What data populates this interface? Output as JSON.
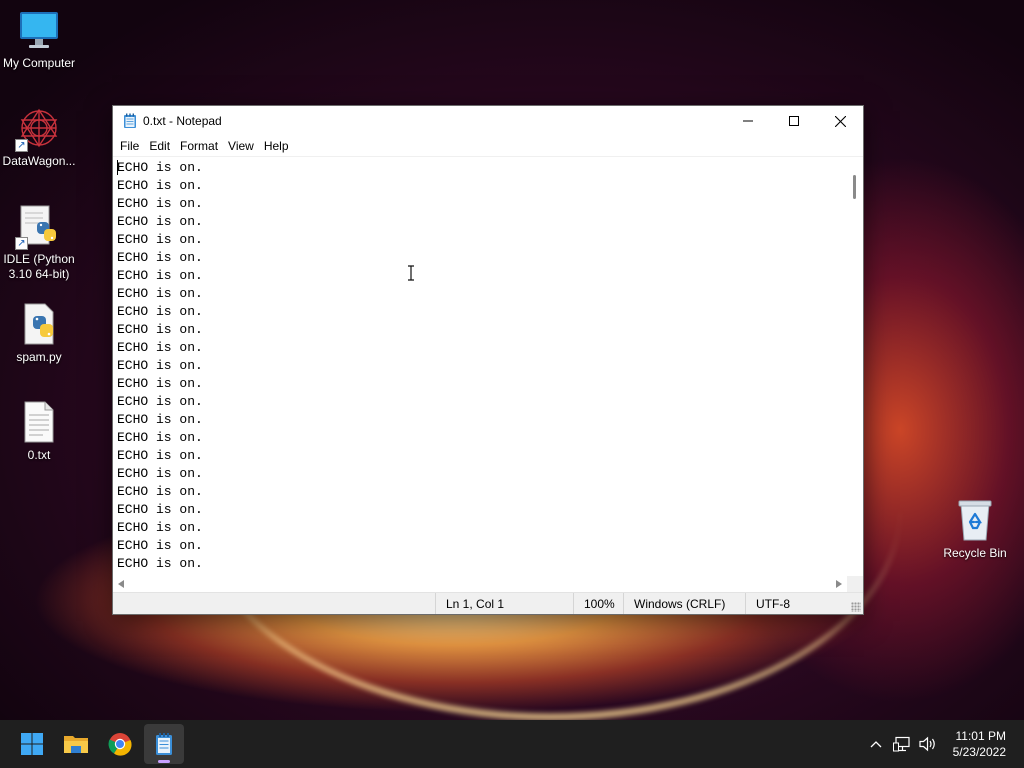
{
  "desktop": {
    "icons": [
      {
        "label": "My Computer",
        "icon": "monitor-icon"
      },
      {
        "label": "DataWagon...",
        "icon": "datawagon-icon"
      },
      {
        "label": "IDLE (Python 3.10 64-bit)",
        "icon": "python-idle-icon"
      },
      {
        "label": "spam.py",
        "icon": "python-file-icon"
      },
      {
        "label": "0.txt",
        "icon": "text-file-icon"
      },
      {
        "label": "Recycle Bin",
        "icon": "recycle-bin-icon"
      }
    ]
  },
  "window": {
    "title": "0.txt - Notepad",
    "menu": [
      "File",
      "Edit",
      "Format",
      "View",
      "Help"
    ],
    "content_line": "ECHO is on.",
    "visible_lines": 23,
    "status": {
      "position": "Ln 1, Col 1",
      "zoom": "100%",
      "line_ending": "Windows (CRLF)",
      "encoding": "UTF-8"
    }
  },
  "taskbar": {
    "apps": [
      "start-icon",
      "file-explorer-icon",
      "chrome-icon",
      "notepad-icon"
    ],
    "active": "notepad-icon",
    "clock": {
      "time": "11:01 PM",
      "date": "5/23/2022"
    }
  }
}
